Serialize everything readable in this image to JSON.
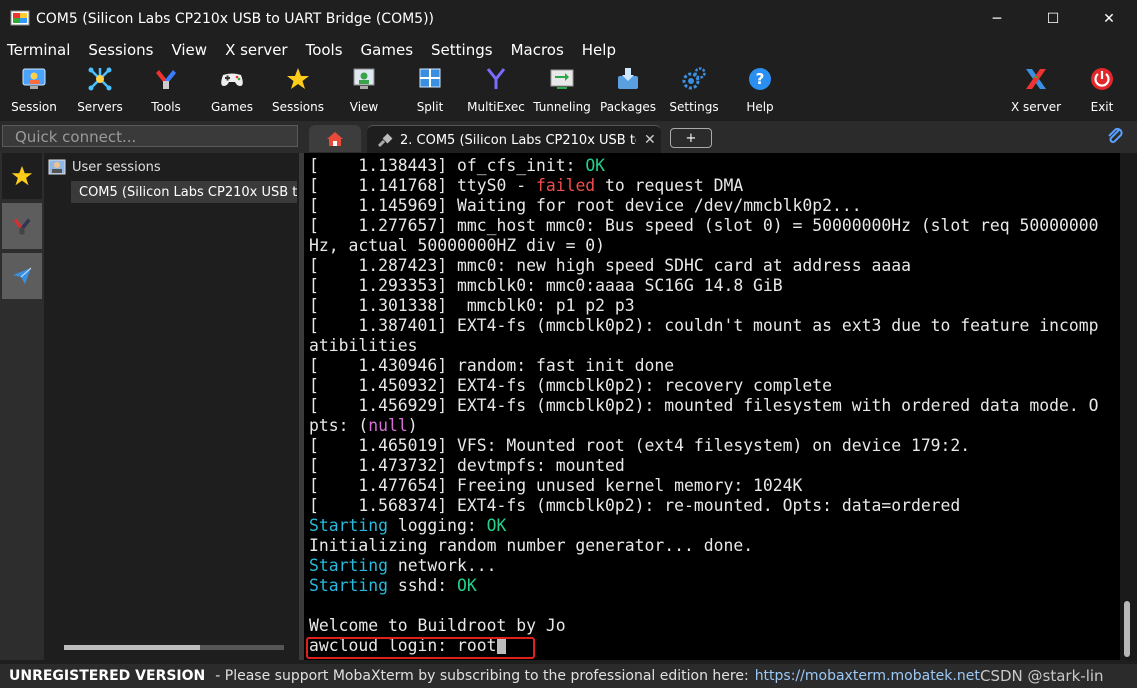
{
  "window": {
    "title": "COM5  (Silicon Labs CP210x USB to UART Bridge (COM5))",
    "minimize": "─",
    "maximize": "☐",
    "close": "✕"
  },
  "menu": {
    "items": [
      "Terminal",
      "Sessions",
      "View",
      "X server",
      "Tools",
      "Games",
      "Settings",
      "Macros",
      "Help"
    ]
  },
  "toolbar": {
    "session": "Session",
    "servers": "Servers",
    "tools": "Tools",
    "games": "Games",
    "sessions": "Sessions",
    "view": "View",
    "split": "Split",
    "multiexec": "MultiExec",
    "tunneling": "Tunneling",
    "packages": "Packages",
    "settings": "Settings",
    "help": "Help",
    "xserver": "X server",
    "exit": "Exit"
  },
  "quick_connect": {
    "placeholder": "Quick connect..."
  },
  "tabs": {
    "active_label": "2. COM5  (Silicon Labs CP210x USB to UART Bridge (COM5))",
    "close": "✕",
    "add": "+"
  },
  "sessions_panel": {
    "group": "User sessions",
    "item": "COM5  (Silicon Labs CP210x USB to UART Bridge (COM5))"
  },
  "terminal": {
    "lines": [
      [
        {
          "t": "[    1.138443] of_cfs_init: "
        },
        {
          "t": "OK",
          "c": "t-green"
        }
      ],
      [
        {
          "t": "[    1.141768] ttyS0 - "
        },
        {
          "t": "failed",
          "c": "t-red"
        },
        {
          "t": " to request DMA"
        }
      ],
      [
        {
          "t": "[    1.145969] Waiting for root device /dev/mmcblk0p2..."
        }
      ],
      [
        {
          "t": "[    1.277657] mmc_host mmc0: Bus speed (slot 0) = 50000000Hz (slot req 50000000"
        }
      ],
      [
        {
          "t": "Hz, actual 50000000HZ div = 0)"
        }
      ],
      [
        {
          "t": "[    1.287423] mmc0: new high speed SDHC card at address aaaa"
        }
      ],
      [
        {
          "t": "[    1.293353] mmcblk0: mmc0:aaaa SC16G 14.8 GiB"
        }
      ],
      [
        {
          "t": "[    1.301338]  mmcblk0: p1 p2 p3"
        }
      ],
      [
        {
          "t": "[    1.387401] EXT4-fs (mmcblk0p2): couldn't mount as ext3 due to feature incomp"
        }
      ],
      [
        {
          "t": "atibilities"
        }
      ],
      [
        {
          "t": "[    1.430946] random: fast init done"
        }
      ],
      [
        {
          "t": "[    1.450932] EXT4-fs (mmcblk0p2): recovery complete"
        }
      ],
      [
        {
          "t": "[    1.456929] EXT4-fs (mmcblk0p2): mounted filesystem with ordered data mode. O"
        }
      ],
      [
        {
          "t": "pts: ("
        },
        {
          "t": "null",
          "c": "t-magenta"
        },
        {
          "t": ")"
        }
      ],
      [
        {
          "t": "[    1.465019] VFS: Mounted root (ext4 filesystem) on device 179:2."
        }
      ],
      [
        {
          "t": "[    1.473732] devtmpfs: mounted"
        }
      ],
      [
        {
          "t": "[    1.477654] Freeing unused kernel memory: 1024K"
        }
      ],
      [
        {
          "t": "[    1.568374] EXT4-fs (mmcblk0p2): re-mounted. Opts: data=ordered"
        }
      ],
      [
        {
          "t": "Starting",
          "c": "t-cyan"
        },
        {
          "t": " logging: "
        },
        {
          "t": "OK",
          "c": "t-green"
        }
      ],
      [
        {
          "t": "Initializing random number generator... done."
        }
      ],
      [
        {
          "t": "Starting",
          "c": "t-cyan"
        },
        {
          "t": " network..."
        }
      ],
      [
        {
          "t": "Starting",
          "c": "t-cyan"
        },
        {
          "t": " sshd: "
        },
        {
          "t": "OK",
          "c": "t-green"
        }
      ],
      [
        {
          "t": ""
        }
      ],
      [
        {
          "t": "Welcome to Buildroot by Jo"
        }
      ],
      [
        {
          "t": "awcloud login: root"
        }
      ]
    ]
  },
  "status": {
    "unregistered": "UNREGISTERED VERSION",
    "message": "-   Please support MobaXterm by subscribing to the professional edition here:",
    "link": "https://mobaxterm.mobatek.net",
    "watermark": "CSDN @stark-lin"
  },
  "colors": {
    "accent_green": "#23d18b",
    "failed_red": "#f14c4c",
    "starting_cyan": "#29b8db",
    "null_magenta": "#d670d6",
    "highlight_box": "#e0201c"
  }
}
